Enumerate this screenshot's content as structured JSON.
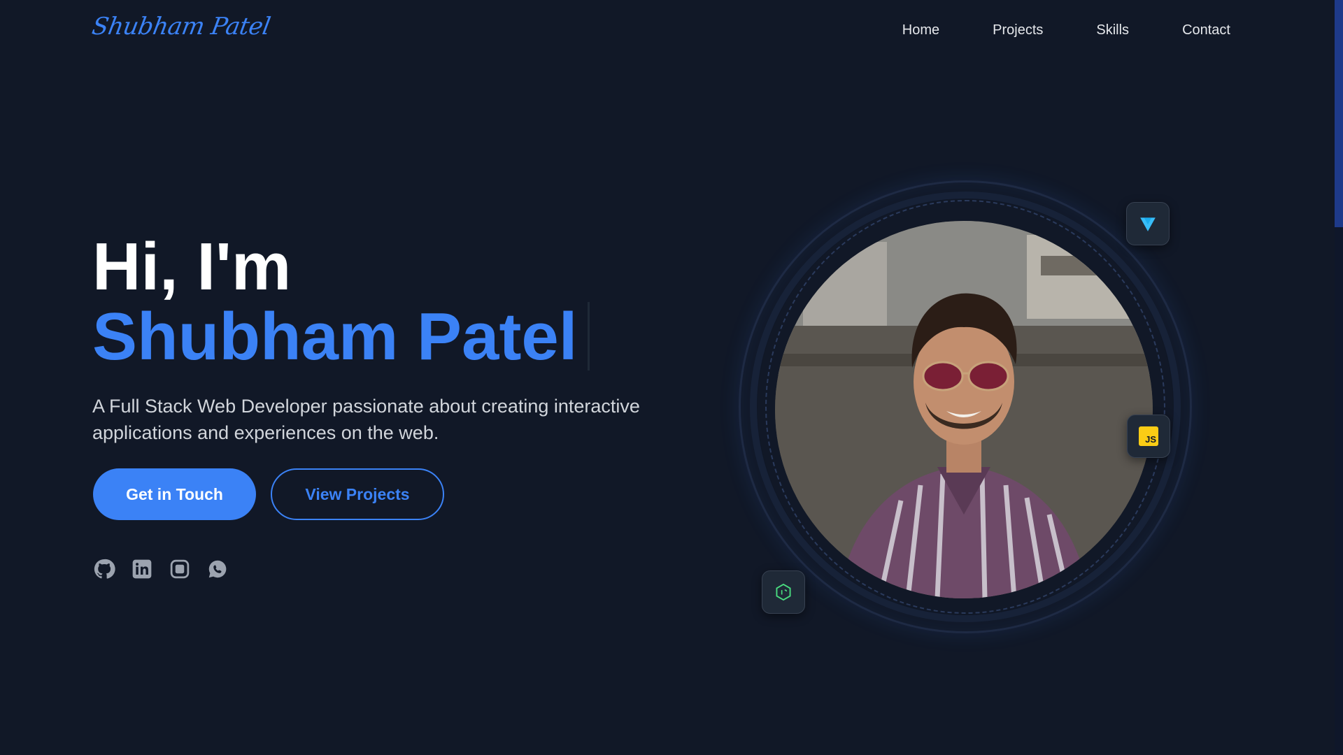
{
  "header": {
    "logo": "Shubham Patel",
    "nav": [
      "Home",
      "Projects",
      "Skills",
      "Contact"
    ]
  },
  "hero": {
    "greeting": "Hi, I'm",
    "name": "Shubham Patel",
    "tagline": "A Full Stack Web Developer passionate about creating interactive applications and experiences on the web.",
    "primary_cta": "Get in Touch",
    "secondary_cta": "View Projects"
  },
  "socials": [
    "github-icon",
    "linkedin-icon",
    "instagram-icon",
    "whatsapp-icon"
  ],
  "tech_badges": [
    {
      "icon": "vue-icon",
      "color": "#38bdf8"
    },
    {
      "icon": "javascript-icon",
      "label": "JS",
      "color": "#facc15"
    },
    {
      "icon": "nodejs-icon",
      "color": "#4ade80"
    }
  ],
  "colors": {
    "background": "#111827",
    "accent": "#3b82f6",
    "text": "#e5e7eb"
  }
}
